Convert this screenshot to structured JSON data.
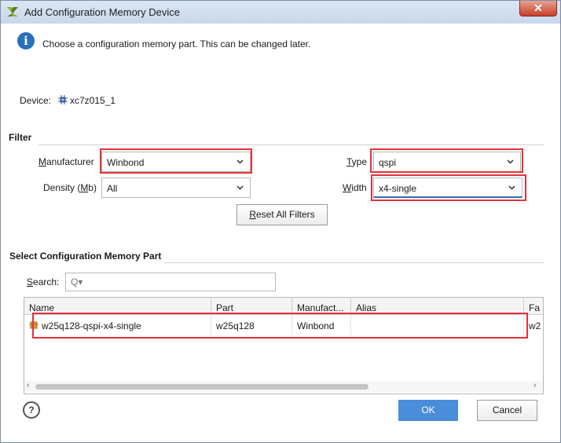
{
  "window": {
    "title": "Add Configuration Memory Device",
    "close_label": "✕"
  },
  "info": {
    "message": "Choose a configuration memory part. This can be changed later."
  },
  "device": {
    "label": "Device:",
    "value": "xc7z015_1"
  },
  "filter": {
    "section_label": "Filter",
    "manufacturer": {
      "label_pre": "M",
      "label_rest": "anufacturer",
      "value": "Winbond"
    },
    "density": {
      "label_pre": "Density (",
      "label_u": "M",
      "label_post": "b)",
      "value": "All"
    },
    "type": {
      "label_pre": "T",
      "label_rest": "ype",
      "value": "qspi"
    },
    "width": {
      "label_pre": "W",
      "label_rest": "idth",
      "value": "x4-single"
    },
    "reset_pre": "R",
    "reset_rest": "eset All Filters"
  },
  "select": {
    "section_label": "Select Configuration Memory Part",
    "search_label_pre": "S",
    "search_label_rest": "earch:",
    "search_placeholder": "Q▾"
  },
  "table": {
    "columns": [
      "Name",
      "Part",
      "Manufact...",
      "Alias",
      "Fa"
    ],
    "rows": [
      {
        "name": "w25q128-qspi-x4-single",
        "part": "w25q128",
        "manufacturer": "Winbond",
        "alias": "",
        "fa": "w2"
      }
    ]
  },
  "buttons": {
    "help": "?",
    "ok": "OK",
    "cancel": "Cancel"
  },
  "colors": {
    "highlight": "#e4313b",
    "ok": "#4a8dd8",
    "info": "#2a6fbd"
  }
}
